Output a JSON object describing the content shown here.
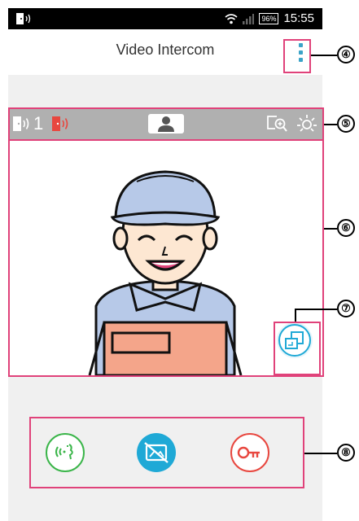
{
  "status_bar": {
    "battery": "96%",
    "time": "15:55",
    "icons": [
      "door-speaker-icon",
      "wifi-icon",
      "signal-icon"
    ]
  },
  "app_bar": {
    "title": "Video Intercom",
    "menu_icon": "overflow-menu-icon"
  },
  "camera_toolbar": {
    "camera_number": "1",
    "icons": [
      "door-camera-icon",
      "door-camera-alert-icon",
      "person-icon",
      "zoom-icon",
      "brightness-icon"
    ]
  },
  "controls": {
    "talk": {
      "icon": "talk-icon",
      "color": "#3bb54a"
    },
    "video_off": {
      "icon": "video-off-icon",
      "color": "#1fa9d6"
    },
    "unlock": {
      "icon": "key-icon",
      "color": "#e8473f"
    }
  },
  "callouts": [
    "④",
    "⑤",
    "⑥",
    "⑦",
    "⑧"
  ],
  "colors": {
    "accent": "#3aa3c8",
    "callout_border": "#e0427a",
    "toolbar_bg": "#b0b0b0"
  }
}
